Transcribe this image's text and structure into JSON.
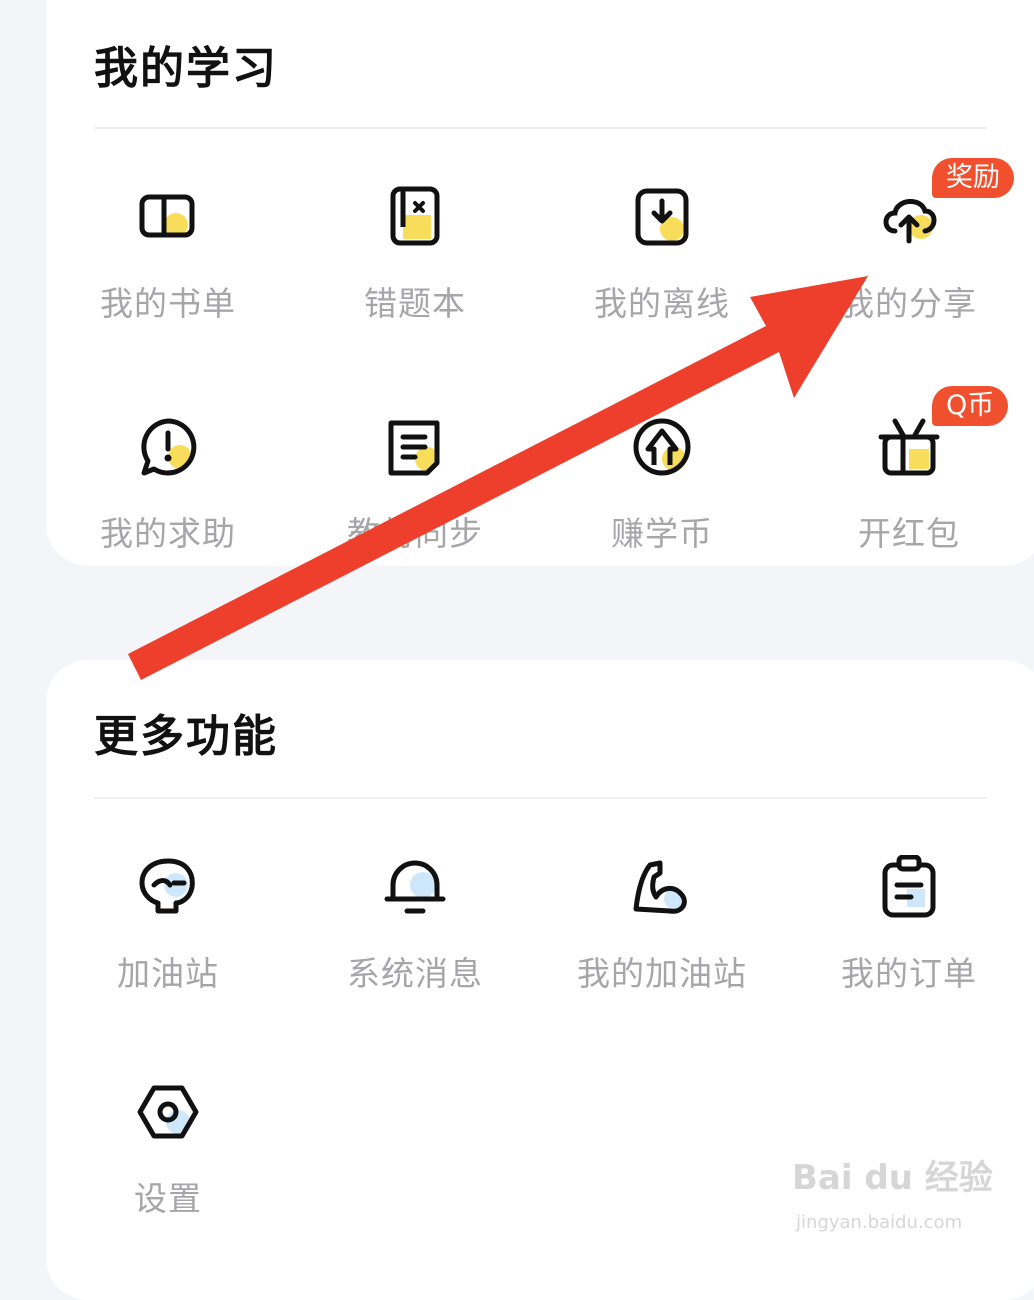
{
  "colors": {
    "accent_yellow": "#f8dd5a",
    "accent_blue": "#cfe7fb",
    "badge": "#f0502d",
    "arrow": "#ee3e2c"
  },
  "study": {
    "title": "我的学习",
    "items": [
      {
        "label": "我的书单",
        "icon": "book-icon"
      },
      {
        "label": "错题本",
        "icon": "mistake-notebook-icon"
      },
      {
        "label": "我的离线",
        "icon": "download-icon"
      },
      {
        "label": "我的分享",
        "icon": "cloud-upload-icon",
        "badge": "奖励"
      },
      {
        "label": "我的求助",
        "icon": "help-bubble-icon"
      },
      {
        "label": "教材同步",
        "icon": "textbook-sync-icon"
      },
      {
        "label": "赚学币",
        "icon": "coin-up-icon"
      },
      {
        "label": "开红包",
        "icon": "gift-icon",
        "badge": "Q币"
      }
    ]
  },
  "more": {
    "title": "更多功能",
    "items": [
      {
        "label": "加油站",
        "icon": "face-icon"
      },
      {
        "label": "系统消息",
        "icon": "bell-icon"
      },
      {
        "label": "我的加油站",
        "icon": "muscle-icon"
      },
      {
        "label": "我的订单",
        "icon": "clipboard-icon"
      },
      {
        "label": "设置",
        "icon": "settings-icon"
      }
    ]
  },
  "watermark": {
    "brand": "Bai du 经验",
    "url": "jingyan.baidu.com"
  }
}
